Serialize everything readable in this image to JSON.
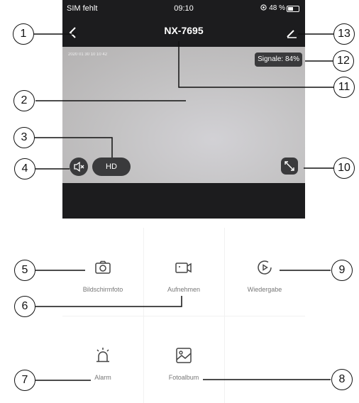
{
  "status_bar": {
    "carrier": "SIM fehlt",
    "time": "09:10",
    "battery_text": "48 %",
    "battery_level": 0.48
  },
  "nav": {
    "title": "NX-7695",
    "back_icon": "back-icon",
    "edit_icon": "edit-icon"
  },
  "video": {
    "timestamp": "2020 01 30 10 10 42",
    "signal_label": "Signale: 84%",
    "quality_label": "HD",
    "mute_icon": "speaker-mute-icon",
    "fullscreen_icon": "fullscreen-icon"
  },
  "actions": [
    {
      "label": "Bildschirmfoto",
      "icon": "camera-icon"
    },
    {
      "label": "Aufnehmen",
      "icon": "video-record-icon"
    },
    {
      "label": "Wiedergabe",
      "icon": "playback-icon"
    },
    {
      "label": "Alarm",
      "icon": "alarm-icon"
    },
    {
      "label": "Fotoalbum",
      "icon": "photo-album-icon"
    }
  ],
  "callouts": [
    "1",
    "2",
    "3",
    "4",
    "5",
    "6",
    "7",
    "8",
    "9",
    "10",
    "11",
    "12",
    "13"
  ],
  "colors": {
    "bar": "#1c1c1e",
    "button": "#3a3a3c",
    "label": "#777777"
  }
}
